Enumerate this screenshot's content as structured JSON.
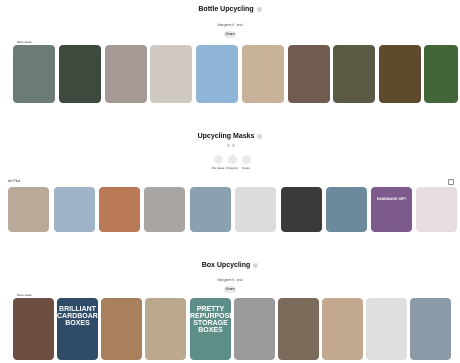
{
  "sections": [
    {
      "title": "Bottle Upcycling",
      "subtitle": "Margaret K. and",
      "action": "Share",
      "more_label": "More ideas",
      "tiles": [
        {
          "name": "glass-bottle-crafts",
          "color": "#6c7b78",
          "text": ""
        },
        {
          "name": "green-bottle-lamp",
          "color": "#3f4a3e",
          "text": ""
        },
        {
          "name": "etched-bottle",
          "color": "#a59b94",
          "text": ""
        },
        {
          "name": "white-bottle-set",
          "color": "#cfc9c2",
          "text": ""
        },
        {
          "name": "bottle-on-table",
          "color": "#8fb6d8",
          "text": ""
        },
        {
          "name": "string-wrapped-bottle",
          "color": "#c9b29a",
          "text": ""
        },
        {
          "name": "painted-bottles",
          "color": "#715a4f",
          "text": ""
        },
        {
          "name": "twig-bottle",
          "color": "#5c5a45",
          "text": ""
        },
        {
          "name": "bottle-wall-lights",
          "color": "#5e4a2c",
          "text": ""
        },
        {
          "name": "green-bottle-row",
          "color": "#40663a",
          "text": ""
        }
      ]
    },
    {
      "title": "Upcycling Masks",
      "row_label": "Art Plus",
      "tools": [
        "Mix Ideas",
        "Organize",
        "Notes"
      ],
      "tiles": [
        {
          "name": "fabric-face-mask",
          "color": "#b9a998",
          "text": ""
        },
        {
          "name": "blue-mask",
          "color": "#9fb3c9",
          "text": ""
        },
        {
          "name": "mask-pattern",
          "color": "#b97a55",
          "text": ""
        },
        {
          "name": "mask-on-girl",
          "color": "#a9a6a3",
          "text": ""
        },
        {
          "name": "floral-masks",
          "color": "#8aa2b0",
          "text": ""
        },
        {
          "name": "mask-strap",
          "color": "#dcdcdc",
          "text": ""
        },
        {
          "name": "mask-bodice",
          "color": "#3a3a3a",
          "text": ""
        },
        {
          "name": "floral-mask-vase",
          "color": "#6d8a9c",
          "text": ""
        },
        {
          "name": "handmade-mask-banner",
          "color": "#7d5a8c",
          "text": "HANDMADE GIFT"
        },
        {
          "name": "pink-mask-pile",
          "color": "#e7dde1",
          "text": ""
        }
      ]
    },
    {
      "title": "Box Upcycling",
      "subtitle": "Margaret K. and",
      "action": "Share",
      "more_label": "More ideas",
      "tiles": [
        {
          "name": "box-crafts-list",
          "color": "#6e4d43",
          "text": ""
        },
        {
          "name": "brilliant-cardboard-boxes",
          "color": "#2f4b68",
          "text": "BRILLIANT CARDBOARD BOXES"
        },
        {
          "name": "cardboard-drawer",
          "color": "#a8805d",
          "text": ""
        },
        {
          "name": "box-shelves",
          "color": "#bba98f",
          "text": ""
        },
        {
          "name": "repurposed-storage-boxes",
          "color": "#5d8f88",
          "text": "PRETTY REPURPOSED STORAGE BOXES"
        },
        {
          "name": "grey-box-tower",
          "color": "#9a9a9a",
          "text": ""
        },
        {
          "name": "box-organizer",
          "color": "#7c6a5a",
          "text": ""
        },
        {
          "name": "box-toy-shelf",
          "color": "#c2a98f",
          "text": ""
        },
        {
          "name": "cube-shelf",
          "color": "#e0dede",
          "text": ""
        },
        {
          "name": "box-storage-ideas",
          "color": "#8a9aa6",
          "text": ""
        }
      ]
    }
  ]
}
